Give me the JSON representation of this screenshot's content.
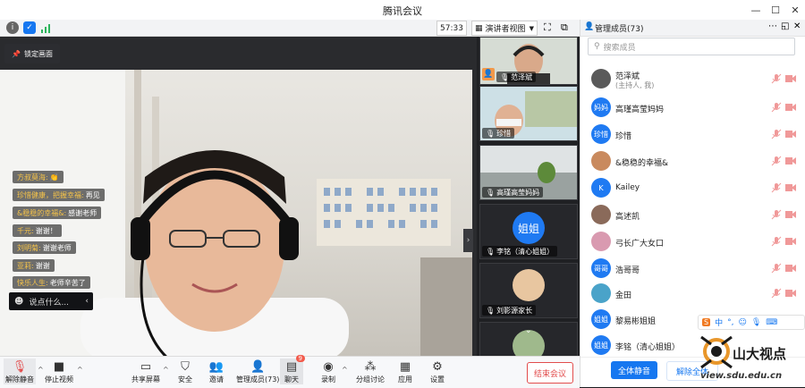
{
  "window": {
    "title": "腾讯会议",
    "controls": [
      "min",
      "max",
      "close"
    ]
  },
  "toolbar": {
    "timer": "57:33",
    "view_mode": "演讲者视图"
  },
  "stage": {
    "lock_button": "锁定画面",
    "chat_messages": [
      {
        "name": "方叔莫海:",
        "text": "👏"
      },
      {
        "name": "珍惜健康，把握幸福:",
        "text": "再见"
      },
      {
        "name": "&稳稳的幸福&:",
        "text": "感谢老师"
      },
      {
        "name": "千元:",
        "text": "谢谢！"
      },
      {
        "name": "刘明菊:",
        "text": "谢谢老师"
      },
      {
        "name": "亚莉:",
        "text": "谢谢"
      },
      {
        "name": "快乐人生:",
        "text": "老师辛苦了"
      }
    ],
    "chat_input_placeholder": "说点什么..."
  },
  "thumbnails": [
    {
      "name": "范泽斌",
      "host": true
    },
    {
      "name": "珍惜"
    },
    {
      "name": "高瑾高莹妈妈"
    },
    {
      "name": "李铭（清心姐姐）",
      "avatar_text": "姐姐",
      "avatar_color": "#1f7af2"
    },
    {
      "name": "刘影源家长"
    },
    {
      "name": ""
    }
  ],
  "bottom_bar": {
    "items": [
      {
        "label": "解除静音",
        "icon": "mic-muted-icon"
      },
      {
        "label": "停止视频",
        "icon": "camera-icon"
      },
      {
        "label": "共享屏幕",
        "icon": "share-screen-icon"
      },
      {
        "label": "安全",
        "icon": "shield-icon"
      },
      {
        "label": "邀请",
        "icon": "invite-icon"
      },
      {
        "label": "管理成员(73)",
        "icon": "members-icon"
      },
      {
        "label": "聊天",
        "icon": "chat-icon",
        "badge": "9"
      },
      {
        "label": "录制",
        "icon": "record-icon"
      },
      {
        "label": "分组讨论",
        "icon": "breakout-icon"
      },
      {
        "label": "应用",
        "icon": "apps-icon"
      },
      {
        "label": "设置",
        "icon": "settings-icon"
      }
    ],
    "end_meeting": "结束会议"
  },
  "panel": {
    "title": "管理成员(73)",
    "search_placeholder": "搜索成员",
    "members": [
      {
        "name": "范泽斌",
        "role": "(主持人, 我)",
        "avatar_text": "",
        "avatar_color": "#5a5a5a"
      },
      {
        "name": "高瑾高莹妈妈",
        "avatar_text": "妈妈",
        "avatar_color": "#1f7af2"
      },
      {
        "name": "珍惜",
        "avatar_text": "珍惜",
        "avatar_color": "#1f7af2"
      },
      {
        "name": "&稳稳的幸福&",
        "avatar_text": "",
        "avatar_color": "#c98a5e"
      },
      {
        "name": "Kailey",
        "avatar_text": "K",
        "avatar_color": "#1f7af2"
      },
      {
        "name": "高述凯",
        "avatar_text": "",
        "avatar_color": "#8a6a5a"
      },
      {
        "name": "弓长广大女口",
        "avatar_text": "",
        "avatar_color": "#d99ab0"
      },
      {
        "name": "浩哥哥",
        "avatar_text": "哥哥",
        "avatar_color": "#1f7af2"
      },
      {
        "name": "金田",
        "avatar_text": "",
        "avatar_color": "#4aa3c9"
      },
      {
        "name": "黎易彬姐姐",
        "avatar_text": "姐姐",
        "avatar_color": "#1f7af2"
      },
      {
        "name": "李铭（清心姐姐）",
        "avatar_text": "姐姐",
        "avatar_color": "#1f7af2"
      }
    ],
    "mute_all": "全体静音",
    "unmute_all": "解除全体"
  },
  "overlay": {
    "ime_label": "中",
    "watermark_name": "山大视点",
    "watermark_url": "view.sdu.edu.cn"
  },
  "colors": {
    "accent": "#1677f0",
    "danger": "#e24c4c",
    "muted_mic": "#f09999"
  }
}
